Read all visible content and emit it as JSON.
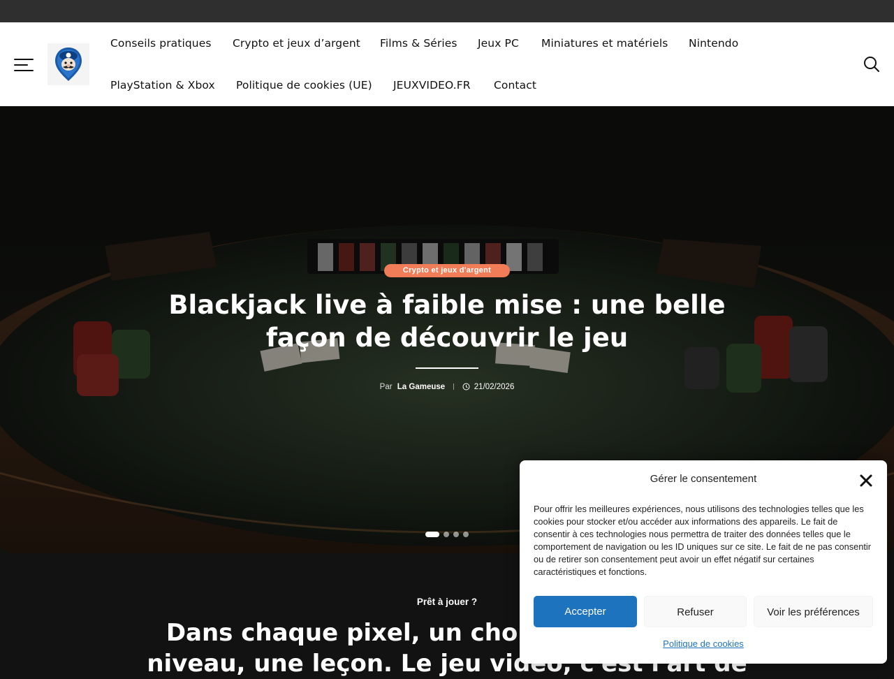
{
  "header": {
    "logo_alt": "site-logo",
    "nav": [
      {
        "label": "Conseils pratiques"
      },
      {
        "label": "Crypto et jeux d’argent"
      },
      {
        "label": "Films & Séries"
      },
      {
        "label": "Jeux PC"
      },
      {
        "label": "Miniatures et matériels"
      },
      {
        "label": "Nintendo"
      },
      {
        "label": "PlayStation & Xbox"
      },
      {
        "label": "Politique de cookies (UE)"
      },
      {
        "label": "JEUXVIDEO.FR"
      },
      {
        "label": "Contact"
      }
    ],
    "menu_icon": "hamburger-icon",
    "search_icon": "search-icon"
  },
  "hero": {
    "category": "Crypto et jeux d'argent",
    "title": "Blackjack live à faible mise : une belle façon de découvrir le jeu",
    "by_label": "Par",
    "author": "La Gameuse",
    "date": "21/02/2026",
    "slides_count": 4,
    "active_slide": 1,
    "accent_color": "#f07d57"
  },
  "section": {
    "kicker": "Prêt à jouer ?",
    "headline": "Dans chaque pixel, un choix, dans chaque niveau, une leçon. Le jeu vidéo, c'est l'art de"
  },
  "cookie_banner": {
    "title": "Gérer le consentement",
    "body": "Pour offrir les meilleures expériences, nous utilisons des technologies telles que les cookies pour stocker et/ou accéder aux informations des appareils. Le fait de consentir à ces technologies nous permettra de traiter des données telles que le comportement de navigation ou les ID uniques sur ce site. Le fait de ne pas consentir ou de retirer son consentement peut avoir un effet négatif sur certaines caractéristiques et fonctions.",
    "accept_label": "Accepter",
    "refuse_label": "Refuser",
    "prefs_label": "Voir les préférences",
    "policy_link": "Politique de cookies",
    "accent_color": "#1e73be"
  }
}
